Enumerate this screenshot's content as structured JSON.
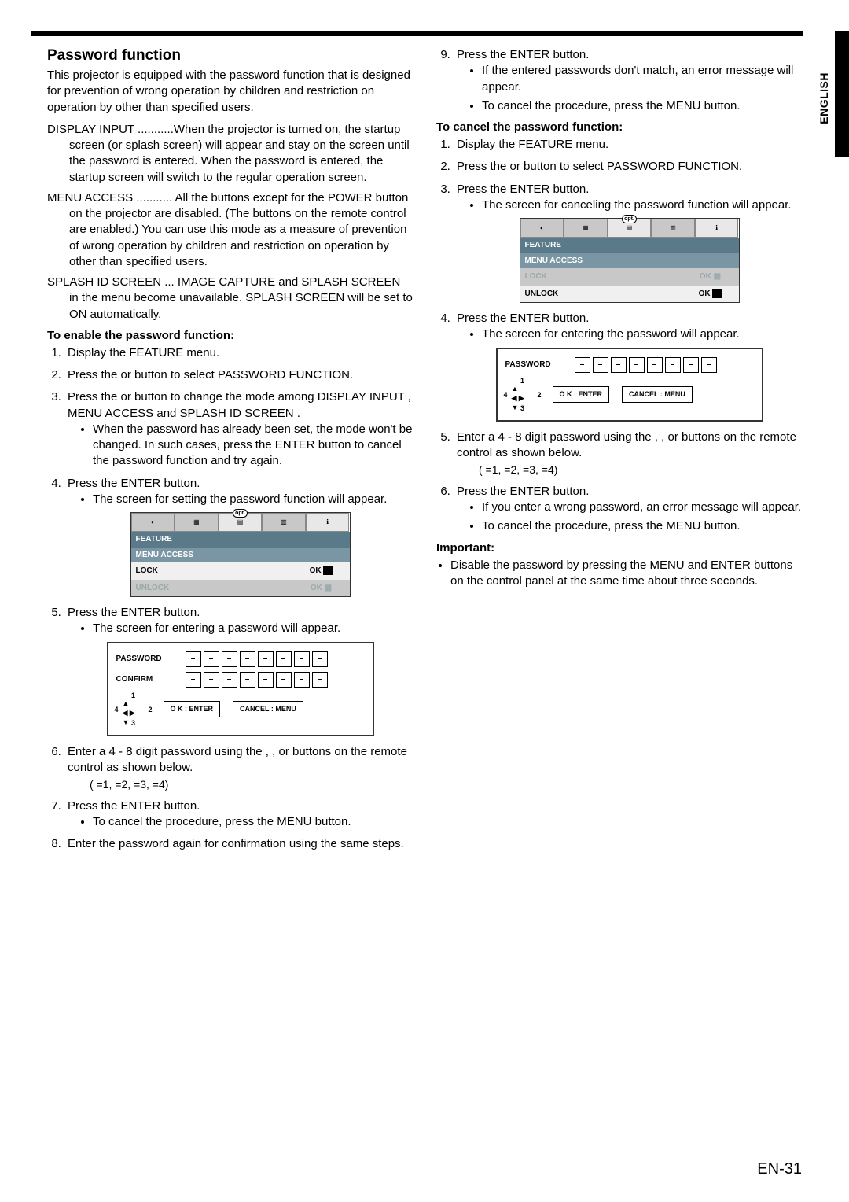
{
  "page": {
    "number": "EN-31",
    "side_label": "ENGLISH"
  },
  "left": {
    "title": "Password function",
    "intro": "This projector is equipped with the password function that is designed for prevention of wrong operation by children and restriction on operation by other than specified users.",
    "defs": {
      "display_input_term": "DISPLAY INPUT ...........",
      "display_input_text": "When the projector is turned on, the startup screen (or splash screen) will appear and stay on the screen until the password is entered. When the password is entered, the startup screen will switch to the regular operation screen.",
      "menu_access_term": "MENU ACCESS ...........",
      "menu_access_text": " All the buttons except for the POWER button on the projector are disabled. (The buttons on the remote control are enabled.) You can use this mode as a measure of prevention of wrong operation by children and restriction on operation by other than specified users.",
      "splash_term": "SPLASH ID SCREEN ...",
      "splash_text": " IMAGE CAPTURE and SPLASH SCREEN in the menu become unavailable. SPLASH SCREEN will be set to ON automatically."
    },
    "enable_heading": "To enable the password function:",
    "steps": {
      "s1": "Display the FEATURE menu.",
      "s2": "Press the  or  button to select PASSWORD FUNCTION.",
      "s3": "Press the  or  button to change the mode among DISPLAY INPUT , MENU ACCESS  and SPLASH ID SCREEN .",
      "s3_b1": "When the password has already been set, the mode won't be changed. In such cases, press the ENTER button to cancel the password function and try again.",
      "s4": "Press the ENTER button.",
      "s4_b1": "The screen for setting the password function will appear.",
      "s5": "Press the ENTER button.",
      "s5_b1": "The screen for entering a password will appear.",
      "s6": "Enter a 4 - 8 digit password using the , , or  buttons on the remote control as shown below.",
      "s6_eq": "( =1,  =2,  =3,  =4)",
      "s7": "Press the ENTER button.",
      "s7_b1": "To cancel the procedure, press the MENU button.",
      "s8": "Enter the password again for confirmation using the same steps."
    },
    "fig1": {
      "header": "FEATURE",
      "subheader": "MENU ACCESS",
      "row1_label": "LOCK",
      "row1_val": "OK",
      "row2_label": "UNLOCK",
      "row2_val": "OK"
    },
    "fig2": {
      "password_label": "PASSWORD",
      "confirm_label": "CONFIRM",
      "ok_label": "O K : ENTER",
      "cancel_label": "CANCEL : MENU",
      "dpad": {
        "up": "1",
        "right": "2",
        "down": "3",
        "left": "4"
      }
    }
  },
  "right": {
    "s9_title": "Press the ENTER button.",
    "s9_b1": "If the entered passwords don't match, an error message will appear.",
    "s9_b2": "To cancel the procedure, press the MENU button.",
    "cancel_heading": "To cancel the password function:",
    "c1": "Display the FEATURE menu.",
    "c2": "Press the  or  button to select PASSWORD FUNCTION.",
    "c3": "Press the ENTER button.",
    "c3_b1": "The screen for canceling the password function will appear.",
    "c4": "Press the ENTER button.",
    "c4_b1": "The screen for entering the password will appear.",
    "c5": "Enter a 4 - 8 digit password using the , , or  buttons on the remote control as shown below.",
    "c5_eq": "( =1,  =2,  =3,  =4)",
    "c6": "Press the ENTER button.",
    "c6_b1": "If you enter a wrong password, an error message will appear.",
    "c6_b2": "To cancel the procedure, press the MENU button.",
    "important_heading": "Important:",
    "important_b1": "Disable the password by pressing the MENU and ENTER buttons on the control panel at the same time about three seconds.",
    "fig1": {
      "header": "FEATURE",
      "subheader": "MENU ACCESS",
      "row1_label": "LOCK",
      "row1_val": "OK",
      "row2_label": "UNLOCK",
      "row2_val": "OK"
    },
    "fig2": {
      "password_label": "PASSWORD",
      "ok_label": "O K : ENTER",
      "cancel_label": "CANCEL : MENU",
      "dpad": {
        "up": "1",
        "right": "2",
        "down": "3",
        "left": "4"
      }
    },
    "opt_label": "opt."
  }
}
